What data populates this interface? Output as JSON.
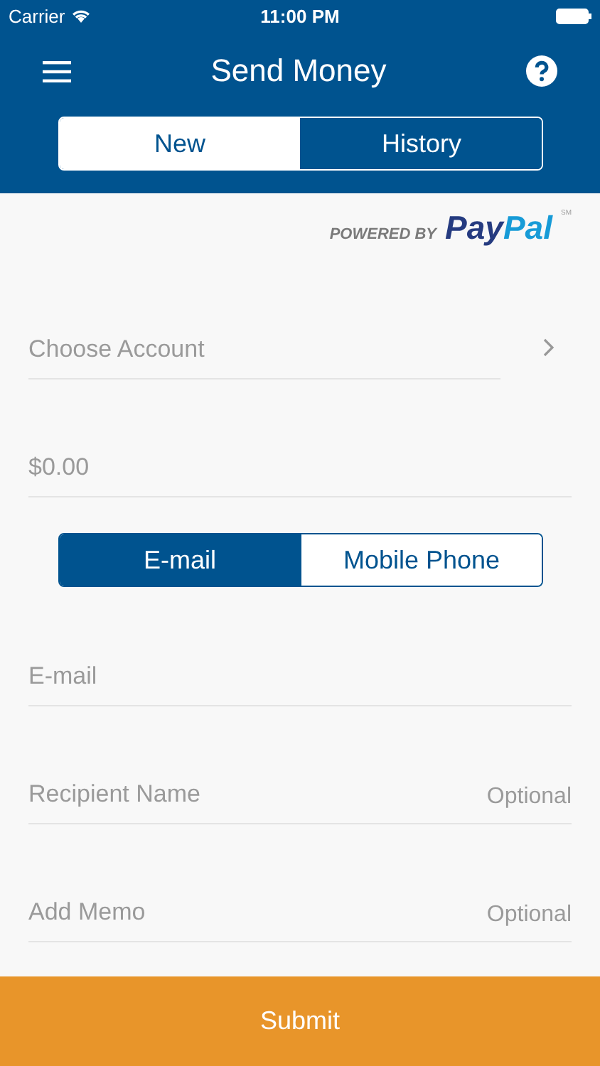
{
  "status_bar": {
    "carrier": "Carrier",
    "time": "11:00 PM"
  },
  "header": {
    "title": "Send Money"
  },
  "tabs": [
    {
      "label": "New",
      "selected": true
    },
    {
      "label": "History",
      "selected": false
    }
  ],
  "powered_by": {
    "prefix": "POWERED BY",
    "brand": [
      "Pay",
      "Pal"
    ],
    "mark": "SM"
  },
  "account": {
    "placeholder": "Choose Account"
  },
  "amount": {
    "placeholder": "$0.00"
  },
  "methods": [
    {
      "label": "E-mail",
      "selected": true
    },
    {
      "label": "Mobile Phone",
      "selected": false
    }
  ],
  "fields": [
    {
      "placeholder": "E-mail"
    },
    {
      "placeholder": "Recipient Name",
      "hint": "Optional"
    },
    {
      "placeholder": "Add Memo",
      "hint": "Optional"
    }
  ],
  "submit": {
    "label": "Submit"
  }
}
